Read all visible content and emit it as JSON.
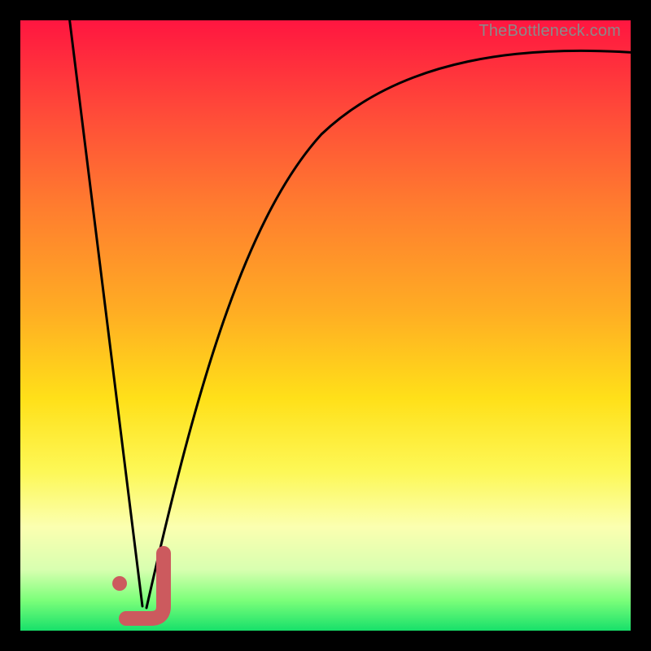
{
  "credit_text": "TheBottleneck.com",
  "colors": {
    "marker": "#cc5a5e",
    "curve": "#000000",
    "frame": "#000000",
    "gradient_stops": [
      "#ff1640",
      "#ff4a39",
      "#ff7b2f",
      "#ffae23",
      "#ffe019",
      "#fdf857",
      "#fbffb0",
      "#d8ffb0",
      "#7cff7a",
      "#17e06a"
    ]
  },
  "chart_data": {
    "type": "line",
    "title": "",
    "xlabel": "",
    "ylabel": "",
    "xlim": [
      0,
      100
    ],
    "ylim": [
      0,
      100
    ],
    "note": "x and y are in percent of plot area; y=0 is bottom. Two curves share a valley near x≈20 then one rises asymptotically while the other falls steeply from top-left.",
    "series": [
      {
        "name": "left-descending",
        "x": [
          8,
          12,
          16,
          20
        ],
        "y": [
          100,
          64,
          28,
          0
        ]
      },
      {
        "name": "right-ascending",
        "x": [
          20,
          24,
          28,
          34,
          42,
          52,
          64,
          78,
          90,
          100
        ],
        "y": [
          0,
          22,
          40,
          58,
          72,
          80,
          86,
          90,
          93,
          94
        ]
      }
    ],
    "annotations": [
      {
        "name": "j-marker",
        "shape": "J",
        "color": "#cc5a5e",
        "approx_center_pct": [
          21,
          4
        ],
        "dot_pct": [
          16.5,
          8
        ]
      }
    ]
  }
}
